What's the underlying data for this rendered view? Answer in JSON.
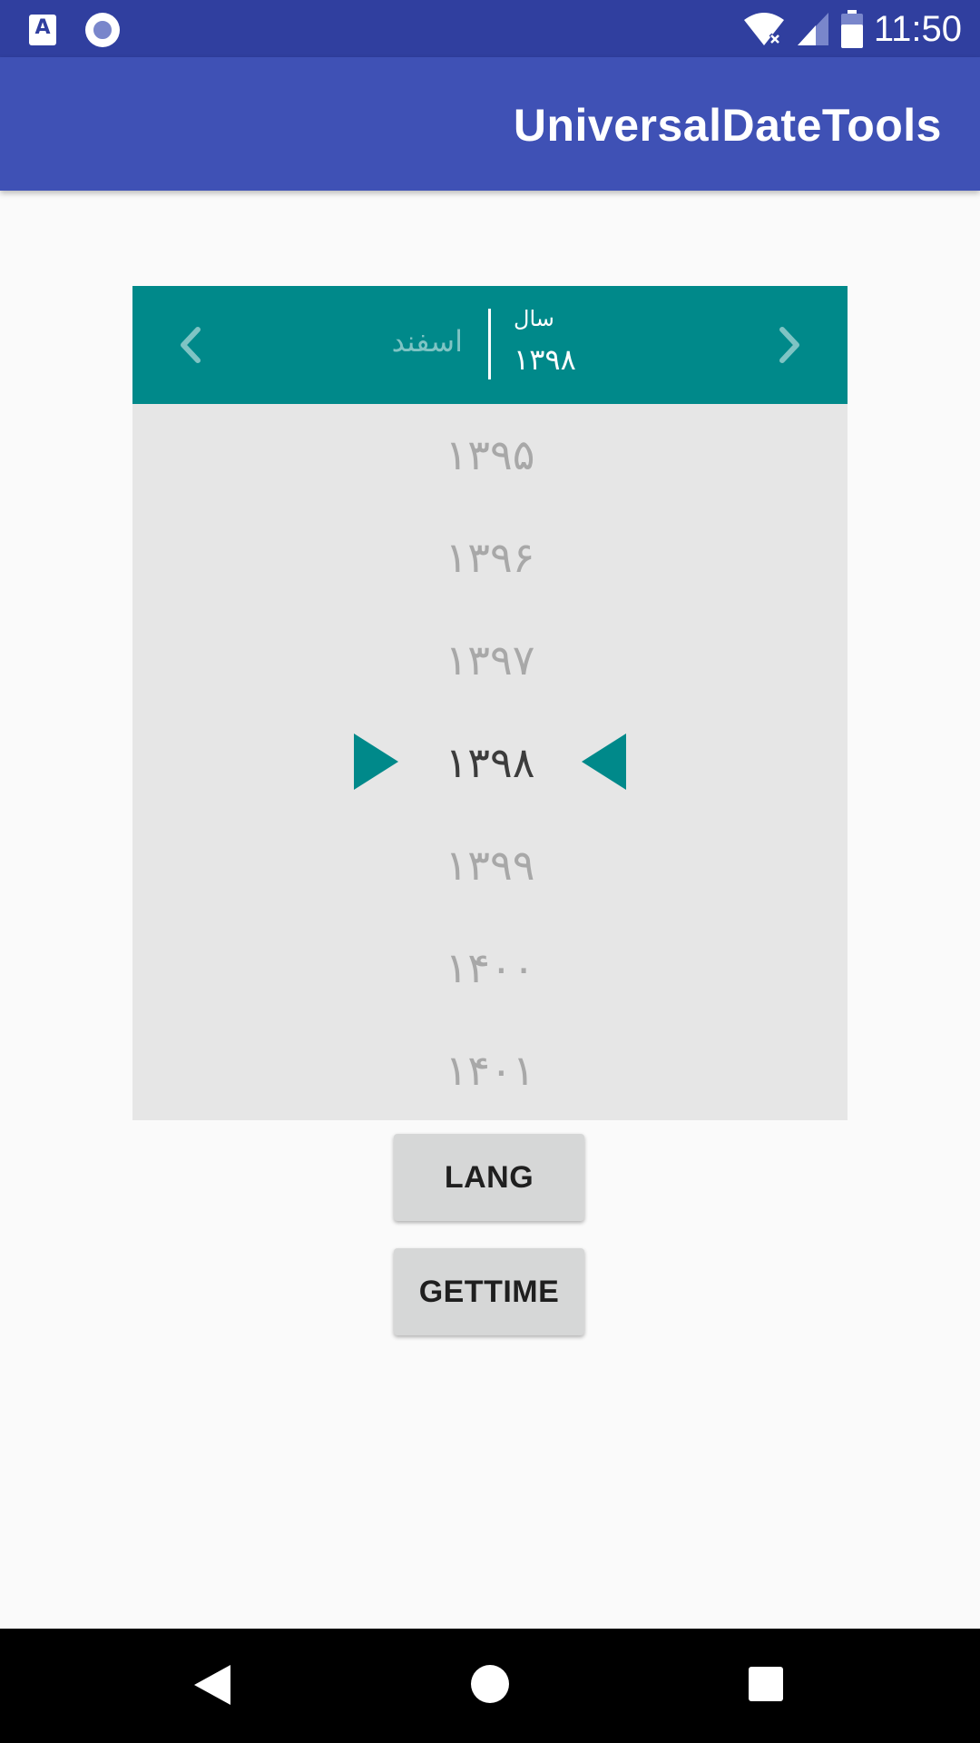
{
  "status_bar": {
    "time": "11:50",
    "icons": [
      "a-notification-icon",
      "circle-notification-icon",
      "wifi-icon",
      "signal-icon",
      "battery-icon"
    ]
  },
  "app_bar": {
    "title": "UniversalDateTools",
    "color": "#3f51b5"
  },
  "picker": {
    "header": {
      "month": "اسفند",
      "year_label": "سال",
      "year_value": "۱۳۹۸",
      "accent_color": "#00898a"
    },
    "years": [
      "۱۳۹۵",
      "۱۳۹۶",
      "۱۳۹۷",
      "۱۳۹۸",
      "۱۳۹۹",
      "۱۴۰۰",
      "۱۴۰۱"
    ],
    "selected_index": 3
  },
  "buttons": {
    "lang_label": "LANG",
    "gettime_label": "GETTIME"
  },
  "nav_bar": {
    "icons": [
      "back-icon",
      "home-icon",
      "recent-apps-icon"
    ]
  }
}
